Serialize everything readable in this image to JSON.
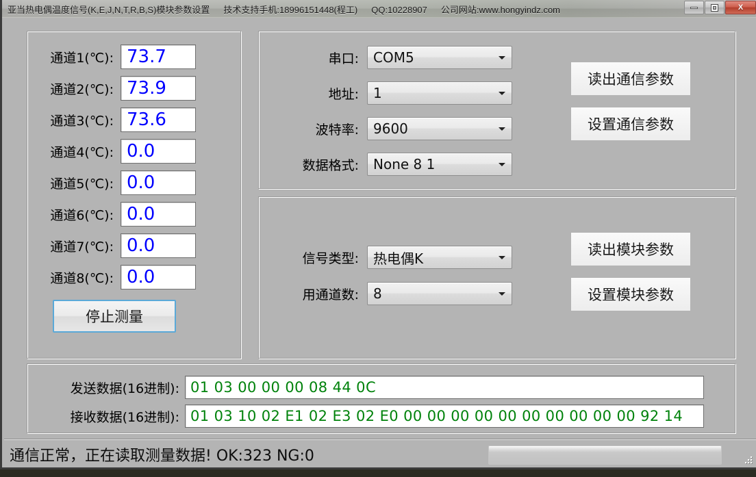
{
  "window": {
    "title_main": "亚当热电偶温度信号(K,E,J,N,T,R,B,S)模块参数设置",
    "title_support": "技术支持手机:18996151448(程工)",
    "title_qq": "QQ:10228907",
    "title_site": "公司网站:www.hongyindz.com",
    "minimize_label": "minimize",
    "maximize_label": "maximize",
    "close_label": "X"
  },
  "channels": {
    "items": [
      {
        "label": "通道1(℃):",
        "value": "73.7"
      },
      {
        "label": "通道2(℃):",
        "value": "73.9"
      },
      {
        "label": "通道3(℃):",
        "value": "73.6"
      },
      {
        "label": "通道4(℃):",
        "value": "0.0"
      },
      {
        "label": "通道5(℃):",
        "value": "0.0"
      },
      {
        "label": "通道6(℃):",
        "value": "0.0"
      },
      {
        "label": "通道7(℃):",
        "value": "0.0"
      },
      {
        "label": "通道8(℃):",
        "value": "0.0"
      }
    ],
    "stop_button": "停止测量",
    "value_color": "#0000ff"
  },
  "comm": {
    "fields": [
      {
        "label": "串口:",
        "value": "COM5"
      },
      {
        "label": "地址:",
        "value": "1"
      },
      {
        "label": "波特率:",
        "value": "9600"
      },
      {
        "label": "数据格式:",
        "value": "None 8 1"
      }
    ],
    "read_button": "读出通信参数",
    "set_button": "设置通信参数"
  },
  "module": {
    "fields": [
      {
        "label": "信号类型:",
        "value": "热电偶K"
      },
      {
        "label": "用通道数:",
        "value": "8"
      }
    ],
    "read_button": "读出模块参数",
    "set_button": "设置模块参数"
  },
  "data": {
    "send_label": "发送数据(16进制):",
    "send_value": "01 03 00 00 00 08 44 0C",
    "recv_label": "接收数据(16进制):",
    "recv_value": "01 03 10 02 E1 02 E3 02 E0 00 00 00 00 00 00 00 00 00 00 92 14",
    "hex_color": "#00820b"
  },
  "status": {
    "message": "通信正常，正在读取测量数据!  OK:323  NG:0",
    "progress_percent": 0
  }
}
